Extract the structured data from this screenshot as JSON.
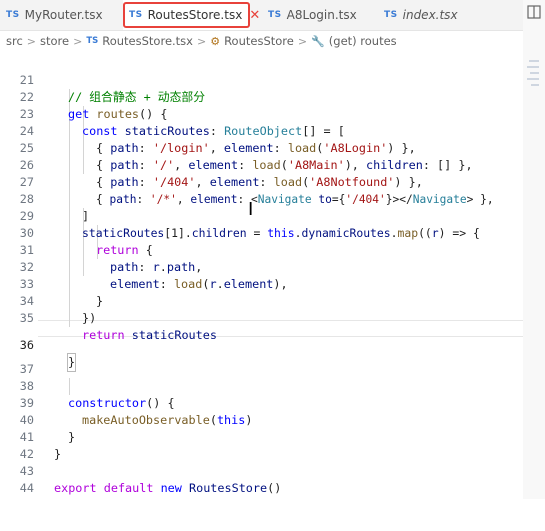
{
  "tabs": [
    {
      "badge": "TS",
      "label": "MyRouter.tsx",
      "active": false,
      "italic": false
    },
    {
      "badge": "TS",
      "label": "RoutesStore.tsx",
      "active": true,
      "italic": false,
      "close": "✕"
    },
    {
      "badge": "TS",
      "label": "A8Login.tsx",
      "active": false,
      "italic": false
    },
    {
      "badge": "TS",
      "label": "index.tsx",
      "active": false,
      "italic": true
    }
  ],
  "breadcrumb": {
    "parts": [
      "src",
      "store",
      "RoutesStore.tsx",
      "RoutesStore",
      "(get) routes"
    ],
    "ts_badge": "TS",
    "separator": ">"
  },
  "editor": {
    "current_line": 36,
    "lines": [
      {
        "n": "21",
        "text": "// 组合静态 + 动态部分"
      },
      {
        "n": "22",
        "text": "get routes() {"
      },
      {
        "n": "23",
        "text": "const staticRoutes: RouteObject[] = ["
      },
      {
        "n": "24",
        "text": "{ path: '/login', element: load('A8Login') },"
      },
      {
        "n": "25",
        "text": "{ path: '/', element: load('A8Main'), children: [] },"
      },
      {
        "n": "26",
        "text": "{ path: '/404', element: load('A8Notfound') },"
      },
      {
        "n": "27",
        "text": "{ path: '/*', element: <Navigate to={'/404'}></Navigate> },"
      },
      {
        "n": "28",
        "text": "]"
      },
      {
        "n": "29",
        "text": "staticRoutes[1].children = this.dynamicRoutes.map((r) => {"
      },
      {
        "n": "30",
        "text": "return {"
      },
      {
        "n": "31",
        "text": "path: r.path,"
      },
      {
        "n": "32",
        "text": "element: load(r.element),"
      },
      {
        "n": "33",
        "text": "}"
      },
      {
        "n": "34",
        "text": "})"
      },
      {
        "n": "35",
        "text": "return staticRoutes"
      },
      {
        "n": "36",
        "text": "}"
      },
      {
        "n": "37",
        "text": ""
      },
      {
        "n": "38",
        "text": "constructor() {"
      },
      {
        "n": "39",
        "text": "makeAutoObservable(this)"
      },
      {
        "n": "40",
        "text": "}"
      },
      {
        "n": "41",
        "text": "}"
      },
      {
        "n": "42",
        "text": ""
      },
      {
        "n": "43",
        "text": "export default new RoutesStore()"
      },
      {
        "n": "44",
        "text": ""
      }
    ]
  },
  "icons": {
    "split_editor": "split-editor-icon",
    "breadcrumb_class": "class-icon",
    "breadcrumb_property": "wrench-icon"
  },
  "colors": {
    "highlight_box": "#e8423b",
    "ts_badge": "#3a7bd5",
    "keyword": "#0000ff",
    "string": "#a31515",
    "comment": "#008000"
  }
}
